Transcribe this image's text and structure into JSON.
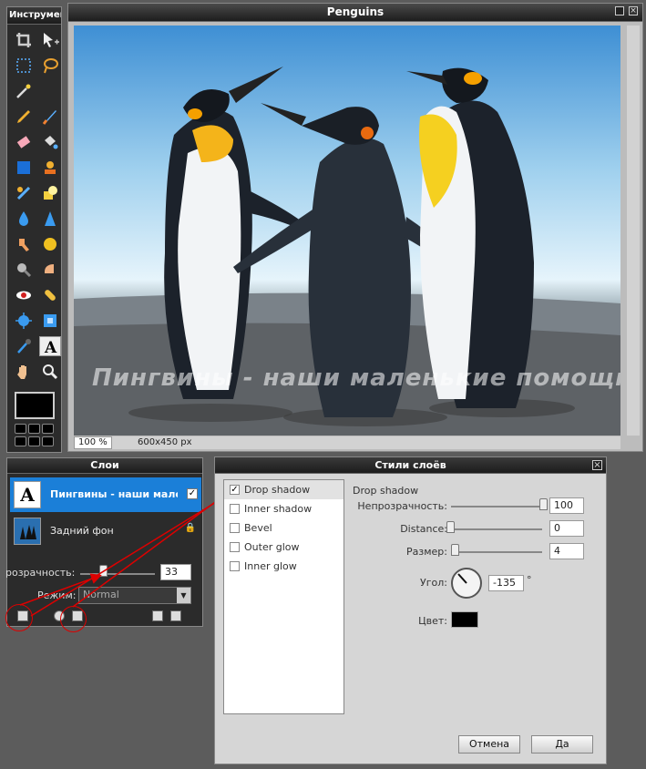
{
  "tools_panel": {
    "title": "Инструмент"
  },
  "image_window": {
    "title": "Penguins",
    "zoom": "100 %",
    "size": "600x450 px",
    "watermark": "Пингвины - наши маленькие помощники"
  },
  "layers_panel": {
    "title": "Слои",
    "layers": [
      {
        "name": "Пингвины - наши малены",
        "thumb": "A",
        "visible": true
      },
      {
        "name": "Задний фон"
      }
    ],
    "opacity_label": "розрачность:",
    "opacity_value": "33",
    "opacity_level": 0.33,
    "mode_label": "Режим:",
    "mode_value": "Normal"
  },
  "styles_dialog": {
    "title": "Стили слоёв",
    "styles": [
      {
        "label": "Drop shadow",
        "checked": true
      },
      {
        "label": "Inner shadow",
        "checked": false
      },
      {
        "label": "Bevel",
        "checked": false
      },
      {
        "label": "Outer glow",
        "checked": false
      },
      {
        "label": "Inner glow",
        "checked": false
      }
    ],
    "section_title": "Drop shadow",
    "opacity_label": "Непрозрачность:",
    "opacity_value": "100",
    "distance_label": "Distance:",
    "distance_value": "0",
    "size_label": "Размер:",
    "size_value": "4",
    "angle_label": "Угол:",
    "angle_value": "-135",
    "degree_symbol": "°",
    "color_label": "Цвет:",
    "shadow_color": "#000000",
    "cancel_label": "Отмена",
    "ok_label": "Да"
  },
  "colors": {
    "highlight": "#1b7fd8",
    "annotation": "#dd0000"
  }
}
